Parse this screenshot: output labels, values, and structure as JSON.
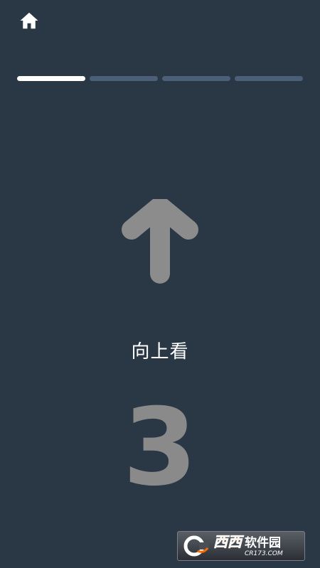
{
  "header": {
    "home_icon": "home-icon"
  },
  "progress": {
    "total_steps": 4,
    "current_step": 1,
    "colors": {
      "active": "#ffffff",
      "inactive": "#4b6078"
    }
  },
  "direction": {
    "icon": "arrow-up-icon",
    "color": "#8c8c8c"
  },
  "instruction": {
    "text": "向上看"
  },
  "countdown": {
    "value": "3"
  },
  "watermark": {
    "brand": "西西",
    "subtitle": "软件园",
    "url": "CR173.COM"
  },
  "colors": {
    "background": "#2a3745",
    "countdown": "#8a8a8a",
    "brand": "#ff6a00"
  }
}
